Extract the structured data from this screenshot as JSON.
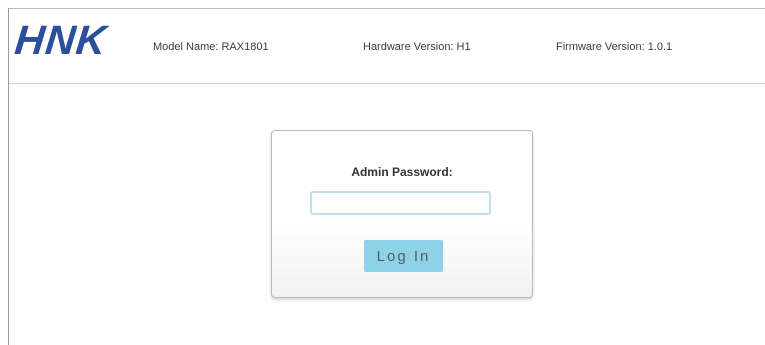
{
  "header": {
    "logo_text": "HNK",
    "model_name": "Model Name: RAX1801",
    "hardware_version": "Hardware Version: H1",
    "firmware_version": "Firmware Version: 1.0.1"
  },
  "login": {
    "password_label": "Admin Password:",
    "password_value": "",
    "button_label": "Log In"
  },
  "colors": {
    "logo": "#2b4f9a",
    "header_divider": "#bfe3b4",
    "button_bg": "#8dd2e6",
    "input_border": "#bfe0ef"
  }
}
